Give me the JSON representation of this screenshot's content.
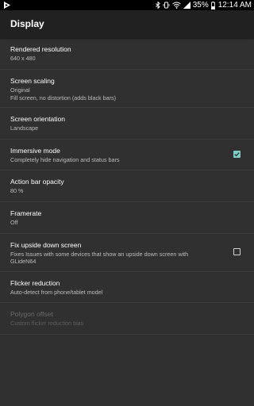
{
  "status_bar": {
    "battery": "35%",
    "time": "12:14 AM"
  },
  "appbar": {
    "title": "Display"
  },
  "preferences": [
    {
      "title": "Rendered resolution",
      "summary": "640 x 480"
    },
    {
      "title": "Screen scaling",
      "summary": "Original",
      "summary2": "Fill screen, no distortion (adds black bars)"
    },
    {
      "title": "Screen orientation",
      "summary": "Landscape"
    },
    {
      "title": "Immersive mode",
      "summary": "Completely hide navigation and status bars",
      "checked": true
    },
    {
      "title": "Action bar opacity",
      "summary": "80 %"
    },
    {
      "title": "Framerate",
      "summary": "Off"
    },
    {
      "title": "Fix upside down screen",
      "summary": "Fixes Issues with some devices that show an upside down screen with",
      "summary2": "GLideN64",
      "checked": false
    },
    {
      "title": "Flicker reduction",
      "summary": "Auto-detect from phone/tablet model"
    },
    {
      "title": "Polygon offset",
      "summary": "Custom flicker reduction bias",
      "enabled": false
    }
  ],
  "colors": {
    "background": "#303030",
    "appbar": "#212121",
    "accent": "#80cbc4"
  }
}
